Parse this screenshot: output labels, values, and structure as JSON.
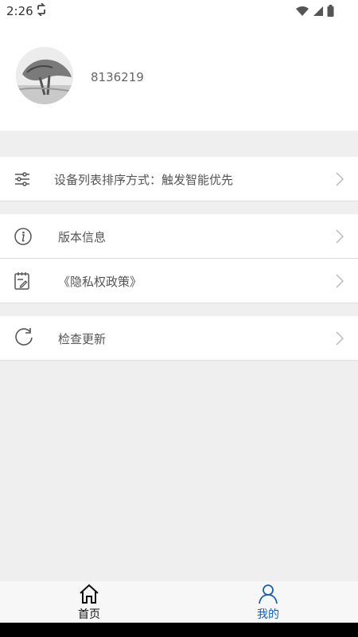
{
  "status": {
    "time": "2:26"
  },
  "profile": {
    "user_id": "8136219"
  },
  "menu": {
    "sort": "设备列表排序方式：触发智能优先",
    "version": "版本信息",
    "privacy": "《隐私权政策》",
    "update": "检查更新"
  },
  "tabs": [
    {
      "label": "首页",
      "icon": "home-icon",
      "active": false
    },
    {
      "label": "我的",
      "icon": "user-icon",
      "active": true
    }
  ],
  "colors": {
    "accent": "#1a5fb4",
    "chevron": "#bbbbbb",
    "divider": "#dcdcdc"
  }
}
